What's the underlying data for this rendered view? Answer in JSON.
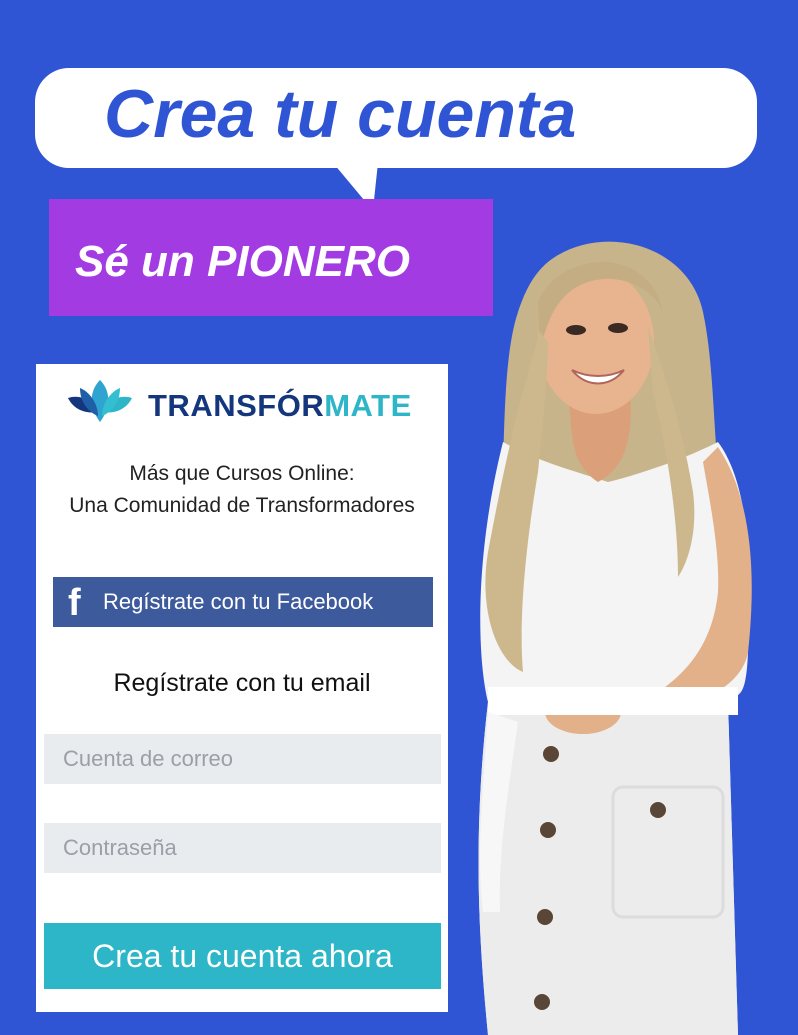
{
  "banner": {
    "title": "Crea tu cuenta",
    "subtitle": "Sé un PIONERO"
  },
  "logo": {
    "icon": "lotus-icon",
    "text_part1": "TRANSFÓR",
    "text_part2": "MATE"
  },
  "tagline": {
    "line1": "Más que Cursos Online:",
    "line2": "Una Comunidad de Transformadores"
  },
  "facebook": {
    "icon": "facebook-icon",
    "label": "Regístrate con tu Facebook"
  },
  "email_section": {
    "heading": "Regístrate con tu email",
    "email_placeholder": "Cuenta de correo",
    "email_value": "",
    "password_placeholder": "Contraseña",
    "password_value": ""
  },
  "cta": {
    "label": "Crea tu cuenta ahora"
  },
  "colors": {
    "background": "#2f55d4",
    "bubble": "#ffffff",
    "pioneer": "#a33be3",
    "facebook": "#3d5a9c",
    "cta": "#2db5c8",
    "logo_dark": "#13367d",
    "logo_accent": "#2db5c8"
  }
}
